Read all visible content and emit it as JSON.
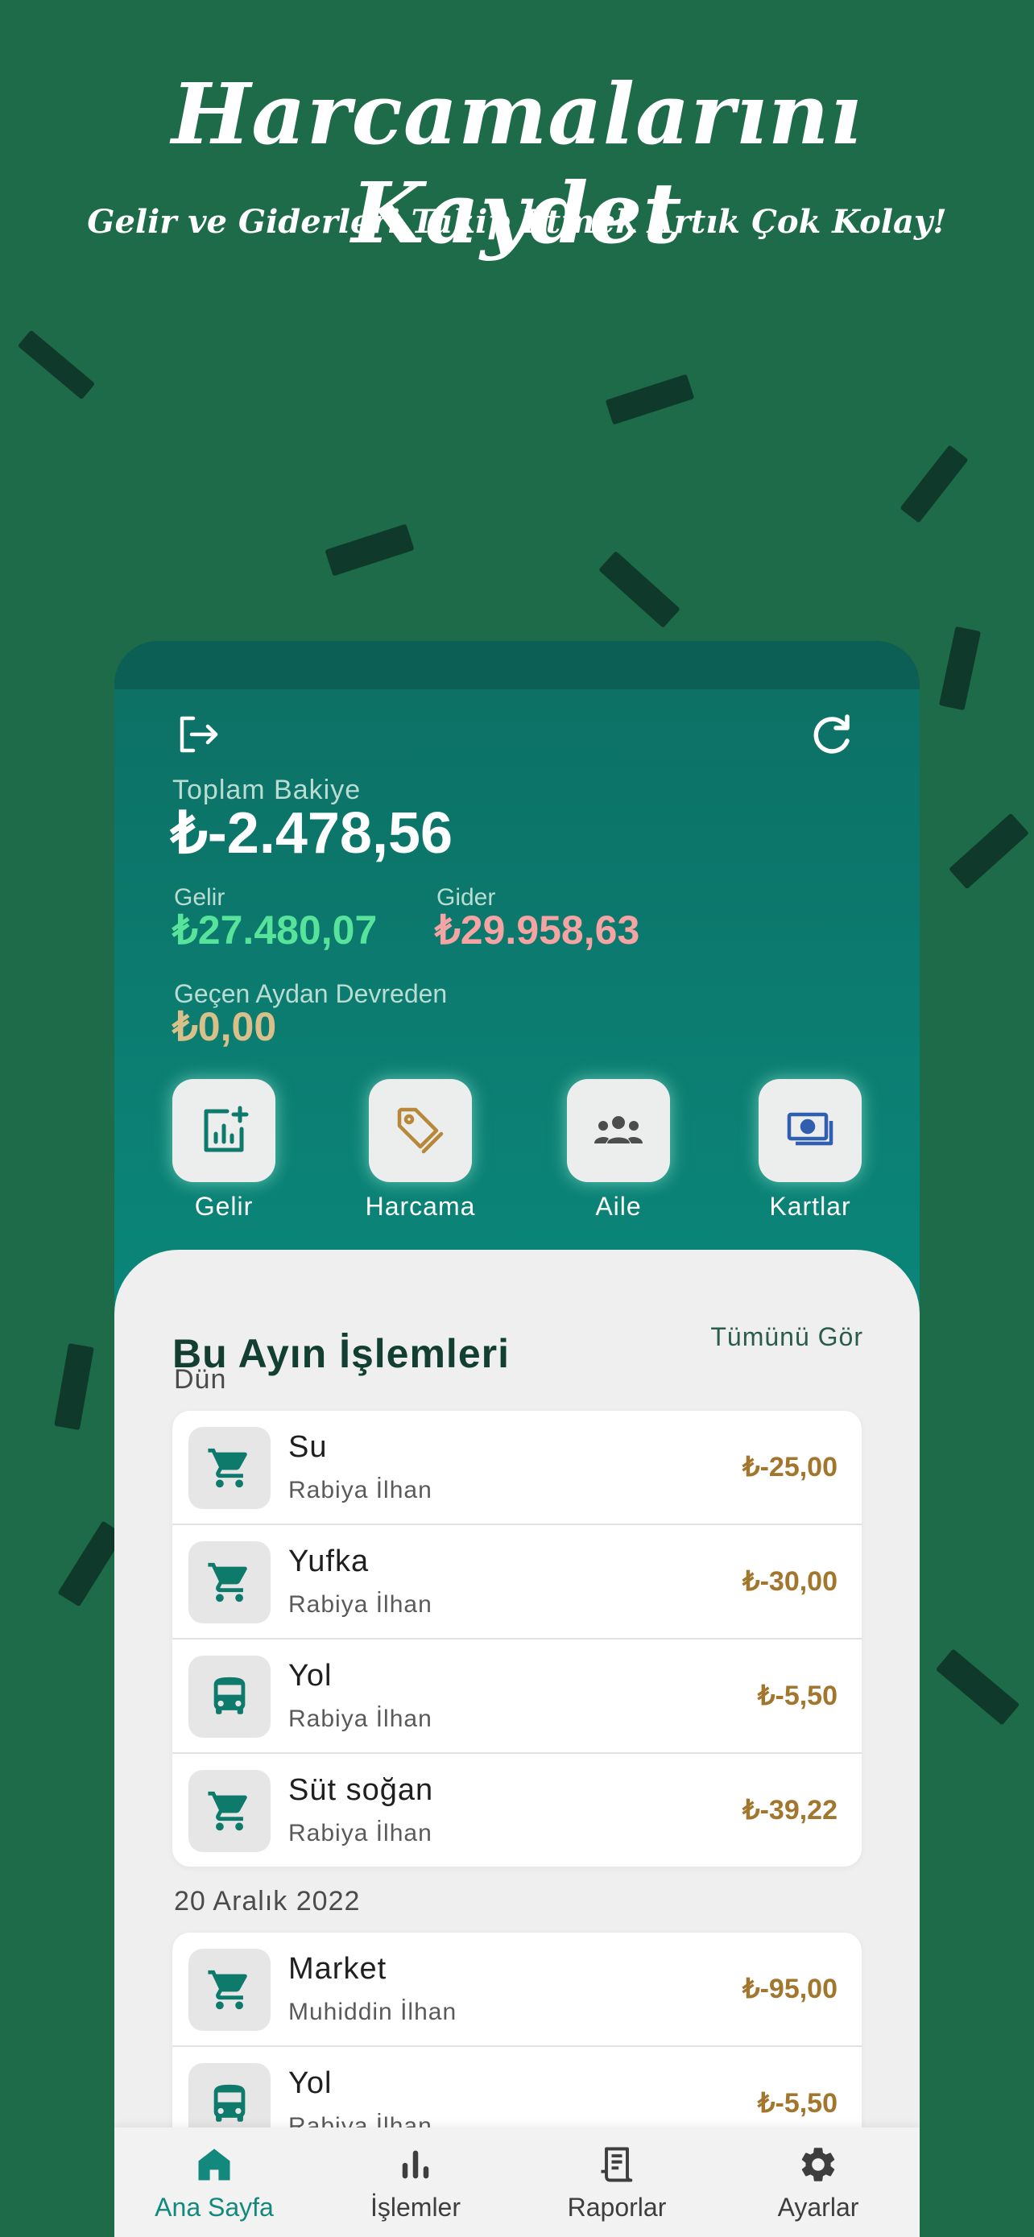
{
  "hero": {
    "title": "Harcamalarını Kaydet",
    "subtitle": "Gelir ve Giderleri Takip Etmek Artık Çok Kolay!"
  },
  "colors": {
    "background": "#1d6b48",
    "header": "#0b8579",
    "income": "#57e39a",
    "expense": "#f5a3a3",
    "carry_over": "#d9c08a",
    "amount": "#a2762c",
    "accent": "#12897c"
  },
  "header": {
    "logout_icon": "logout-icon",
    "refresh_icon": "refresh-icon",
    "balance_label": "Toplam Bakiye",
    "balance_value": "₺-2.478,56",
    "income_label": "Gelir",
    "income_value": "₺27.480,07",
    "expense_label": "Gider",
    "expense_value": "₺29.958,63",
    "carry_label": "Geçen Aydan Devreden",
    "carry_value": "₺0,00"
  },
  "actions": [
    {
      "label": "Gelir",
      "icon": "add-chart-icon"
    },
    {
      "label": "Harcama",
      "icon": "tag-icon"
    },
    {
      "label": "Aile",
      "icon": "group-icon"
    },
    {
      "label": "Kartlar",
      "icon": "cards-icon"
    }
  ],
  "transactions": {
    "title": "Bu Ayın İşlemleri",
    "see_all": "Tümünü Gör",
    "groups": [
      {
        "date": "Dün",
        "items": [
          {
            "name": "Su",
            "person": "Rabiya İlhan",
            "amount": "₺-25,00",
            "icon": "cart-icon"
          },
          {
            "name": "Yufka",
            "person": "Rabiya İlhan",
            "amount": "₺-30,00",
            "icon": "cart-icon"
          },
          {
            "name": "Yol",
            "person": "Rabiya İlhan",
            "amount": "₺-5,50",
            "icon": "bus-icon"
          },
          {
            "name": "Süt soğan",
            "person": "Rabiya İlhan",
            "amount": "₺-39,22",
            "icon": "cart-icon"
          }
        ]
      },
      {
        "date": "20 Aralık 2022",
        "items": [
          {
            "name": "Market",
            "person": "Muhiddin İlhan",
            "amount": "₺-95,00",
            "icon": "cart-icon"
          },
          {
            "name": "Yol",
            "person": "Rabiya İlhan",
            "amount": "₺-5,50",
            "icon": "bus-icon"
          }
        ]
      }
    ]
  },
  "nav": [
    {
      "label": "Ana Sayfa",
      "icon": "home-icon",
      "active": true
    },
    {
      "label": "İşlemler",
      "icon": "bar-chart-icon",
      "active": false
    },
    {
      "label": "Raporlar",
      "icon": "receipt-icon",
      "active": false
    },
    {
      "label": "Ayarlar",
      "icon": "gear-icon",
      "active": false
    }
  ]
}
